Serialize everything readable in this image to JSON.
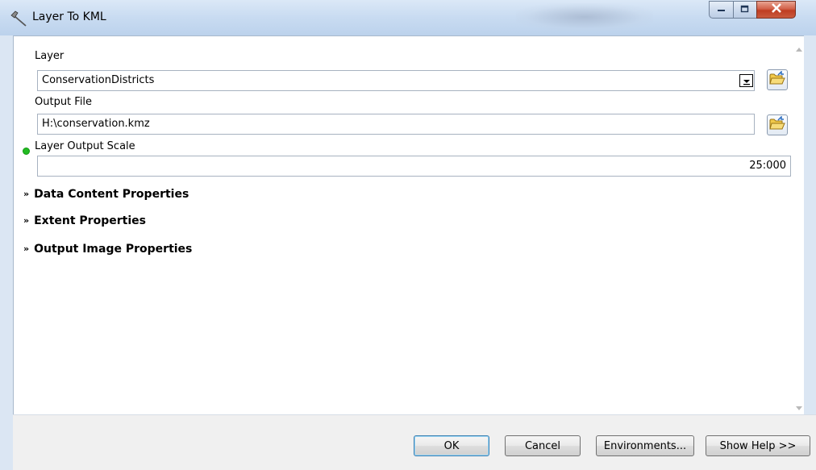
{
  "window": {
    "title": "Layer To KML",
    "caption_buttons": [
      "minimize",
      "maximize",
      "close"
    ]
  },
  "form": {
    "layer": {
      "label": "Layer",
      "value": "ConservationDistricts"
    },
    "output_file": {
      "label": "Output File",
      "value": "H:\\conservation.kmz"
    },
    "output_scale": {
      "label": "Layer Output Scale",
      "value": "25:000",
      "required_indicator_color": "#22bb22"
    }
  },
  "sections": [
    {
      "label": "Data Content Properties",
      "expanded": false
    },
    {
      "label": "Extent Properties",
      "expanded": false
    },
    {
      "label": "Output Image Properties",
      "expanded": false
    }
  ],
  "buttons": {
    "ok": "OK",
    "cancel": "Cancel",
    "environments": "Environments...",
    "show_help": "Show Help >>"
  },
  "icons": {
    "app": "hammer-icon",
    "browse": "open-folder-icon",
    "combo": "dropdown-arrow-icon",
    "section": "double-chevron-down-icon"
  }
}
